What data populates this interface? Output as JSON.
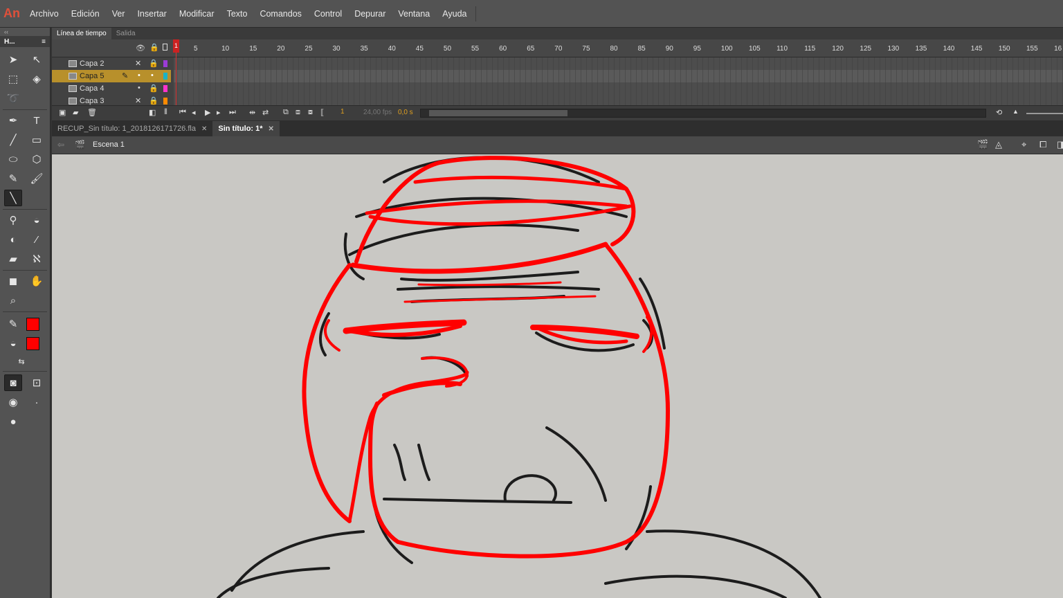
{
  "app": {
    "logo": "An"
  },
  "menu": [
    "Archivo",
    "Edición",
    "Ver",
    "Insertar",
    "Modificar",
    "Texto",
    "Comandos",
    "Control",
    "Depurar",
    "Ventana",
    "Ayuda"
  ],
  "tools_panel": {
    "collapse": "‹‹",
    "title": "H...",
    "menu": "≡"
  },
  "timeline": {
    "tabs": [
      "Línea de tiempo",
      "Salida"
    ],
    "ruler": [
      "5",
      "10",
      "15",
      "20",
      "25",
      "30",
      "35",
      "40",
      "45",
      "50",
      "55",
      "60",
      "65",
      "70",
      "75",
      "80",
      "85",
      "90",
      "95",
      "100",
      "105",
      "110",
      "115",
      "120",
      "125",
      "130",
      "135",
      "140",
      "145",
      "150",
      "155",
      "16"
    ],
    "current_frame_marker": "1",
    "layers": [
      {
        "name": "Capa 2",
        "color": "#9b3bd6",
        "selected": false
      },
      {
        "name": "Capa 5",
        "color": "#1ab3c4",
        "selected": true
      },
      {
        "name": "Capa 4",
        "color": "#ff33cc",
        "selected": false
      },
      {
        "name": "Capa 3",
        "color": "#ff8a00",
        "selected": false
      }
    ],
    "current_frame": "1",
    "fps": "24,00 fps",
    "time": "0,0 s"
  },
  "doc_tabs": [
    {
      "label": "RECUP_Sin título: 1_2018126171726.fla",
      "active": false
    },
    {
      "label": "Sin título: 1*",
      "active": true
    }
  ],
  "scene": {
    "label": "Escena 1"
  },
  "colors": {
    "stroke": "#ff0000",
    "fill": "#ff0000",
    "accent_layer": "#b8902b"
  }
}
